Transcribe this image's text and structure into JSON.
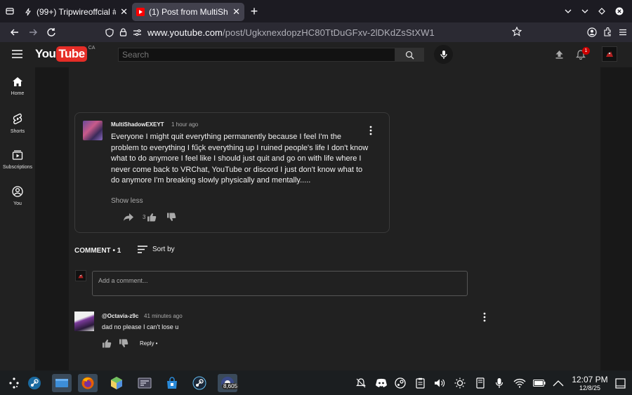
{
  "browser": {
    "tabs": [
      {
        "title": "(99+) Tripwireoffcial #Ac",
        "active": false,
        "favicon": "lightning-icon"
      },
      {
        "title": "(1) Post from MultiShado",
        "active": true,
        "favicon": "youtube-icon"
      }
    ],
    "url_domain": "www.youtube.com",
    "url_path": "/post/UgkxnexdopzHC80TtDuGFxv-2lDKdZsStXW1"
  },
  "youtube": {
    "logo_you": "You",
    "logo_tube": "Tube",
    "country_code": "CA",
    "search_placeholder": "Search",
    "notification_count": "1",
    "guide": [
      {
        "label": "Home",
        "icon": "home-icon"
      },
      {
        "label": "Shorts",
        "icon": "shorts-icon"
      },
      {
        "label": "Subscriptions",
        "icon": "subscriptions-icon"
      },
      {
        "label": "You",
        "icon": "you-icon"
      }
    ]
  },
  "post": {
    "author": "MultiShadowEXEYT",
    "time": "1 hour ago",
    "text": "Everyone I might quit everything permanently because I feel I'm the problem to everything I fűçk everything up I ruined people's life I don't know what to do anymore I feel like I should just quit and go on with life where I never come back to VRChat, YouTube or discord I just don't know what to do anymore I'm breaking slowly physically and mentally.....",
    "show_less": "Show less",
    "like_count": "3"
  },
  "comments_section": {
    "header": "COMMENT • 1",
    "sort_label": "Sort by",
    "add_placeholder": "Add a comment...",
    "comments": [
      {
        "author": "@Octavia-z9c",
        "time": "41 minutes ago",
        "text": "dad no please I can't lose u",
        "reply_label": "Reply •"
      }
    ]
  },
  "taskbar": {
    "time": "12:07 PM",
    "date": "12/8/25",
    "steam_badge": "8,605"
  }
}
